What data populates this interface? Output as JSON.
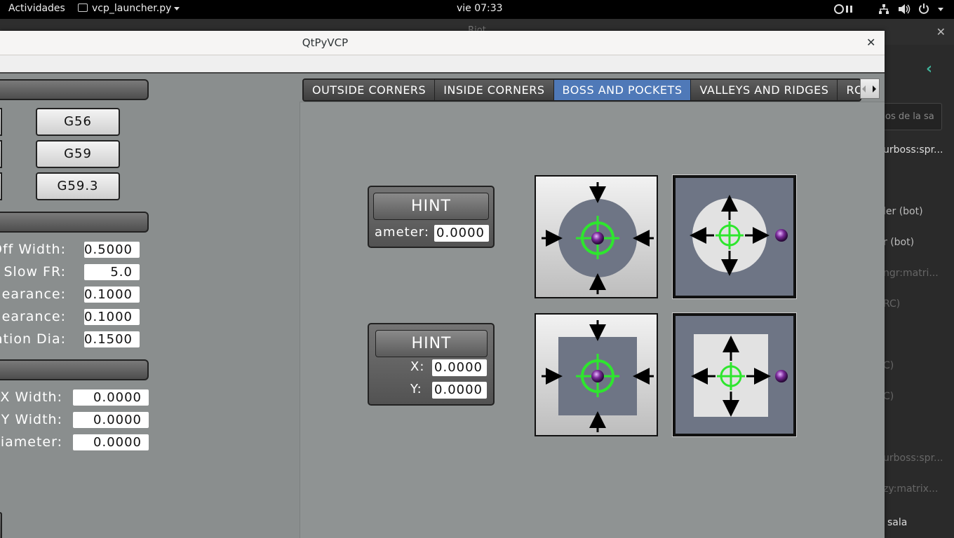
{
  "topbar": {
    "activities": "Actividades",
    "app_menu": "vcp_launcher.py",
    "clock": "vie 07:33"
  },
  "background_window": {
    "title": "Riot",
    "search_placeholder": "os de la sa",
    "sidebar_items": [
      "urboss:spr...",
      "ler (bot)",
      "r (bot)",
      "ngr:matri...",
      "RC)",
      "C)",
      "C)",
      "urboss:spr...",
      "zy:matrix...",
      "sala"
    ]
  },
  "dialog": {
    "title": "QtPyVCP"
  },
  "left_panel": {
    "gcode_buttons": [
      "G56",
      "G59",
      "G59.3"
    ],
    "params": [
      {
        "label": "Off Width:",
        "value": "0.5000"
      },
      {
        "label": "e Slow FR:",
        "value": "5.0"
      },
      {
        "label": "Clearance:",
        "value": "0.1000"
      },
      {
        "label": "Clearance:",
        "value": "0.1000"
      },
      {
        "label": "ation Dia:",
        "value": "0.1500"
      }
    ],
    "results": [
      {
        "label": "X Width:",
        "value": "0.0000"
      },
      {
        "label": "Y Width:",
        "value": "0.0000"
      },
      {
        "label": "Diameter:",
        "value": "0.0000"
      }
    ]
  },
  "tabs": {
    "items": [
      "OUTSIDE CORNERS",
      "INSIDE CORNERS",
      "BOSS AND POCKETS",
      "VALLEYS AND RIDGES",
      "RO"
    ],
    "active": "BOSS AND POCKETS"
  },
  "hint_round": {
    "button": "HINT",
    "label": "ameter:",
    "value": "0.0000"
  },
  "hint_rect": {
    "button": "HINT",
    "x_label": "X:",
    "x_value": "0.0000",
    "y_label": "Y:",
    "y_value": "0.0000"
  },
  "colors": {
    "active_tab": "#4f79b8",
    "target_green": "#2ee62e",
    "probe_purple": "#6a1f86",
    "accent_teal": "#3fb39a"
  }
}
